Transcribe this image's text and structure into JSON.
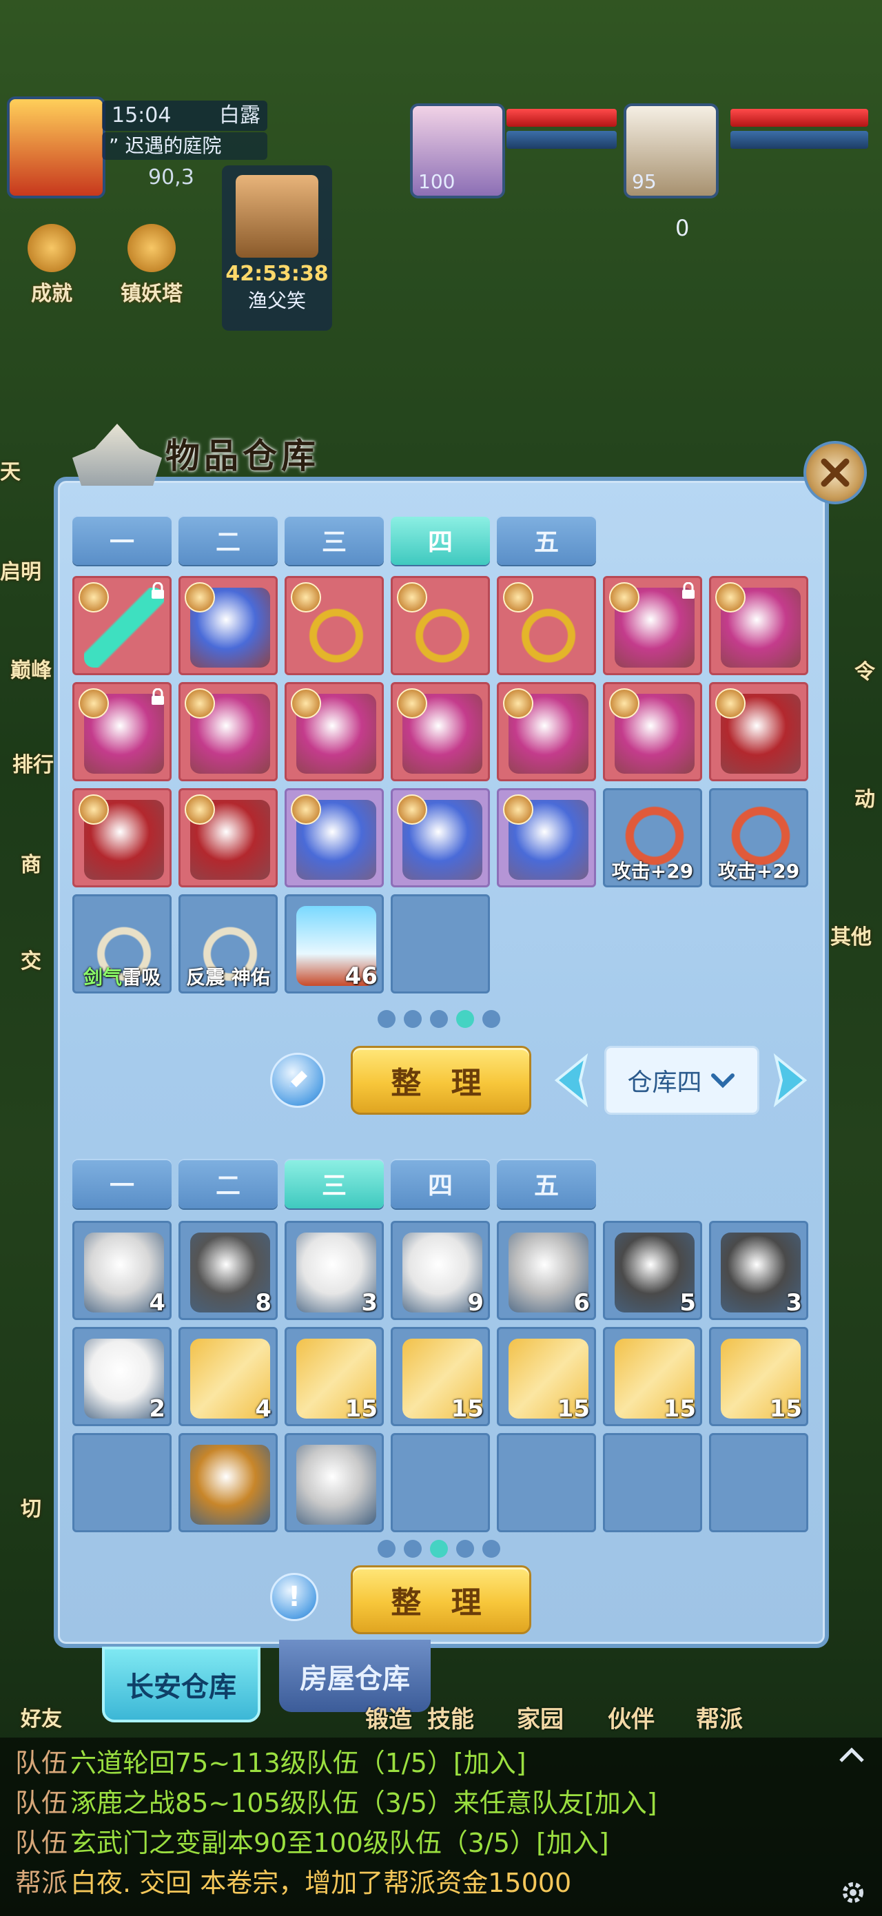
{
  "hud": {
    "time": "15:04",
    "solar_term": "白露",
    "location": "” 迟遇的庭院",
    "gold": "90,3",
    "features": [
      "成就",
      "镇妖塔"
    ],
    "npc": {
      "timer": "42:53:38",
      "name": "渔父笑"
    },
    "pets": [
      {
        "level": "100"
      },
      {
        "level": "95"
      }
    ],
    "counter": "0"
  },
  "side_labels": [
    "天",
    "启明",
    "巅峰",
    "排行",
    "商",
    "交",
    "切",
    "好友"
  ],
  "right_labels": [
    "令",
    "动",
    "其他"
  ],
  "panel": {
    "title": "物品仓库",
    "upper_tabs": [
      "一",
      "二",
      "三",
      "四",
      "五"
    ],
    "upper_active_tab": 3,
    "upper_items": [
      {
        "name": "jade-dagger-icon",
        "tone": "r",
        "locked": true,
        "color": "#3ee0c0"
      },
      {
        "name": "eye-belt-icon",
        "tone": "r",
        "color": "#4a6bd8"
      },
      {
        "name": "gold-necklace-icon",
        "tone": "r",
        "color": "#e4b52a"
      },
      {
        "name": "gold-necklace-icon",
        "tone": "r",
        "color": "#e4b52a"
      },
      {
        "name": "gold-necklace-icon",
        "tone": "r",
        "color": "#e4b52a"
      },
      {
        "name": "feather-robe-icon",
        "tone": "r",
        "locked": true,
        "color": "#c43c8c"
      },
      {
        "name": "feather-robe-icon",
        "tone": "r",
        "color": "#c43c8c"
      },
      {
        "name": "feather-robe-icon",
        "tone": "r",
        "locked": true,
        "color": "#c43c8c"
      },
      {
        "name": "feather-robe-icon",
        "tone": "r",
        "color": "#c43c8c"
      },
      {
        "name": "feather-robe-icon",
        "tone": "r",
        "color": "#c43c8c"
      },
      {
        "name": "feather-robe-icon",
        "tone": "r",
        "color": "#c43c8c"
      },
      {
        "name": "feather-robe-icon",
        "tone": "r",
        "color": "#c43c8c"
      },
      {
        "name": "feather-robe-icon",
        "tone": "r",
        "color": "#c43c8c"
      },
      {
        "name": "phoenix-helmet-icon",
        "tone": "r",
        "color": "#b3282e"
      },
      {
        "name": "phoenix-helmet-icon",
        "tone": "r",
        "color": "#b3282e"
      },
      {
        "name": "phoenix-helmet-icon",
        "tone": "r",
        "color": "#b3282e"
      },
      {
        "name": "eye-belt-icon",
        "tone": "p",
        "color": "#4a6bd8"
      },
      {
        "name": "eye-belt-icon",
        "tone": "p",
        "color": "#4a6bd8"
      },
      {
        "name": "eye-belt-icon",
        "tone": "p",
        "color": "#4a6bd8"
      },
      {
        "name": "bell-bracelet-icon",
        "tone": "b",
        "label": "攻击+29",
        "color": "#e05a3a"
      },
      {
        "name": "bell-bracelet-icon",
        "tone": "b",
        "label": "攻击+29",
        "color": "#e05a3a"
      },
      {
        "name": "bead-necklace-icon",
        "tone": "b",
        "label_green": "剑气",
        "label": "雷吸",
        "color": "#e8e0c8"
      },
      {
        "name": "bead-necklace-icon",
        "tone": "b",
        "label": "反震 神佑",
        "color": "#e8e0c8"
      },
      {
        "name": "crystal-icon",
        "tone": "b",
        "count": "46",
        "color": "#7ad9ff"
      },
      {
        "name": "empty-slot",
        "tone": "b"
      }
    ],
    "upper_pages": 5,
    "upper_page_active": 3,
    "sort_label": "整 理",
    "warehouse_select": "仓库四",
    "lower_tabs": [
      "一",
      "二",
      "三",
      "四",
      "五"
    ],
    "lower_active_tab": 2,
    "lower_items": [
      {
        "name": "spiky-fruit-icon",
        "count": "4",
        "color": "#d8d8d8"
      },
      {
        "name": "peach-icon",
        "count": "8",
        "color": "#555555"
      },
      {
        "name": "lychee-icon",
        "count": "3",
        "color": "#e6e6e6"
      },
      {
        "name": "lychee-icon",
        "count": "9",
        "color": "#e6e6e6"
      },
      {
        "name": "spiky-fruit-icon",
        "count": "6",
        "color": "#bdbdbd"
      },
      {
        "name": "dragon-fruit-icon",
        "count": "5",
        "color": "#4a4a4a"
      },
      {
        "name": "dragon-fruit-icon",
        "count": "3",
        "color": "#4a4a4a"
      },
      {
        "name": "pear-icon",
        "count": "2",
        "color": "#f0f0f0"
      },
      {
        "name": "scroll-icon",
        "count": "4",
        "color": "#f2c14a"
      },
      {
        "name": "scroll-icon",
        "count": "15",
        "color": "#f2c14a"
      },
      {
        "name": "scroll-icon",
        "count": "15",
        "color": "#f2c14a"
      },
      {
        "name": "scroll-icon",
        "count": "15",
        "color": "#f2c14a"
      },
      {
        "name": "scroll-icon",
        "count": "15",
        "color": "#f2c14a"
      },
      {
        "name": "scroll-icon",
        "count": "15",
        "color": "#f2c14a"
      },
      {
        "name": "empty-slot"
      },
      {
        "name": "money-bag-icon",
        "color": "#c8862a"
      },
      {
        "name": "ghost-pet-icon",
        "color": "#c9c9c9"
      },
      {
        "name": "empty-slot"
      },
      {
        "name": "empty-slot"
      },
      {
        "name": "empty-slot"
      },
      {
        "name": "empty-slot"
      }
    ],
    "lower_pages": 5,
    "lower_page_active": 2,
    "lower_sort_label": "整 理"
  },
  "bottom_tabs": {
    "active": "长安仓库",
    "inactive": "房屋仓库"
  },
  "bottom_nav": [
    "锻造",
    "技能",
    "家园",
    "伙伴",
    "帮派"
  ],
  "chat": [
    {
      "channel": "队伍",
      "text": "六道轮回75~113级队伍（1/5）",
      "link": "[加入]"
    },
    {
      "channel": "队伍",
      "text": "涿鹿之战85~105级队伍（3/5）来任意队友",
      "link": "[加入]"
    },
    {
      "channel": "队伍",
      "text": "玄武门之变副本90至100级队伍（3/5）",
      "link": "[加入]"
    },
    {
      "channel": "帮派",
      "text": "白夜. 交回 本卷宗，增加了帮派资金15000",
      "link": ""
    }
  ],
  "colors": {
    "accent": "#45d3c3",
    "panel": "#a6cbec",
    "gold_button": "#f7c63a"
  }
}
